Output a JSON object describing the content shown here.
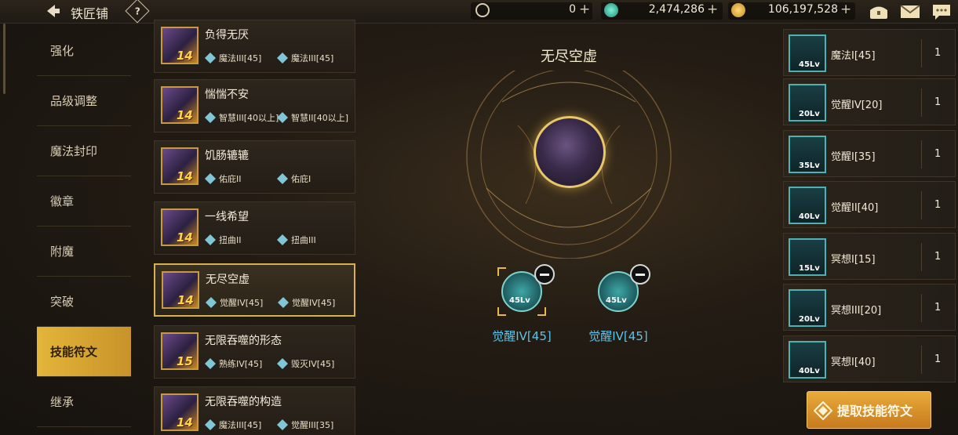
{
  "header": {
    "title": "铁匠铺",
    "help_glyph": "?",
    "currencies": [
      {
        "icon": "c-coin-icon",
        "value": "0"
      },
      {
        "icon": "gem-icon",
        "value": "2,474,286"
      },
      {
        "icon": "gold-coin-icon",
        "value": "106,197,528"
      }
    ],
    "plus_glyph": "+",
    "right_icons": [
      "chest-icon",
      "mail-icon",
      "chat-icon"
    ]
  },
  "nav": {
    "items": [
      {
        "label": "强化",
        "active": false
      },
      {
        "label": "品级调整",
        "active": false
      },
      {
        "label": "魔法封印",
        "active": false
      },
      {
        "label": "徽章",
        "active": false
      },
      {
        "label": "附魔",
        "active": false
      },
      {
        "label": "突破",
        "active": false
      },
      {
        "label": "技能符文",
        "active": true
      },
      {
        "label": "继承",
        "active": false
      }
    ]
  },
  "runes": [
    {
      "name": "负得无厌",
      "level": "14",
      "skills": [
        "魔法III[45]",
        "魔法III[45]"
      ],
      "selected": false
    },
    {
      "name": "惴惴不安",
      "level": "14",
      "skills": [
        "智慧III[40以上]",
        "智慧II[40以上]"
      ],
      "selected": false
    },
    {
      "name": "饥肠辘辘",
      "level": "14",
      "skills": [
        "佑庇II",
        "佑庇I"
      ],
      "selected": false
    },
    {
      "name": "一线希望",
      "level": "14",
      "skills": [
        "扭曲II",
        "扭曲III"
      ],
      "selected": false
    },
    {
      "name": "无尽空虚",
      "level": "14",
      "skills": [
        "觉醒IV[45]",
        "觉醒IV[45]"
      ],
      "selected": true
    },
    {
      "name": "无限吞噬的形态",
      "level": "15",
      "skills": [
        "熟练IV[45]",
        "毁灭IV[45]"
      ],
      "selected": false
    },
    {
      "name": "无限吞噬的构造",
      "level": "14",
      "skills": [
        "魔法III[45]",
        "觉醒III[35]"
      ],
      "selected": false
    }
  ],
  "center": {
    "title": "无尽空虚",
    "slots": [
      {
        "level": "45Lv",
        "label": "觉醒IV[45]"
      },
      {
        "level": "45Lv",
        "label": "觉醒IV[45]"
      }
    ]
  },
  "materials": [
    {
      "level": "45Lv",
      "name": "魔法I[45]",
      "qty": "1"
    },
    {
      "level": "20Lv",
      "name": "觉醒IV[20]",
      "qty": "1"
    },
    {
      "level": "35Lv",
      "name": "觉醒I[35]",
      "qty": "1"
    },
    {
      "level": "40Lv",
      "name": "觉醒II[40]",
      "qty": "1"
    },
    {
      "level": "15Lv",
      "name": "冥想I[15]",
      "qty": "1"
    },
    {
      "level": "20Lv",
      "name": "冥想III[20]",
      "qty": "1"
    },
    {
      "level": "40Lv",
      "name": "冥想I[40]",
      "qty": "1"
    }
  ],
  "extract_button": {
    "label": "提取技能符文"
  },
  "colors": {
    "accent": "#e3b53a",
    "slot_label": "#5fc3e8",
    "button": "#e9ab3a"
  }
}
